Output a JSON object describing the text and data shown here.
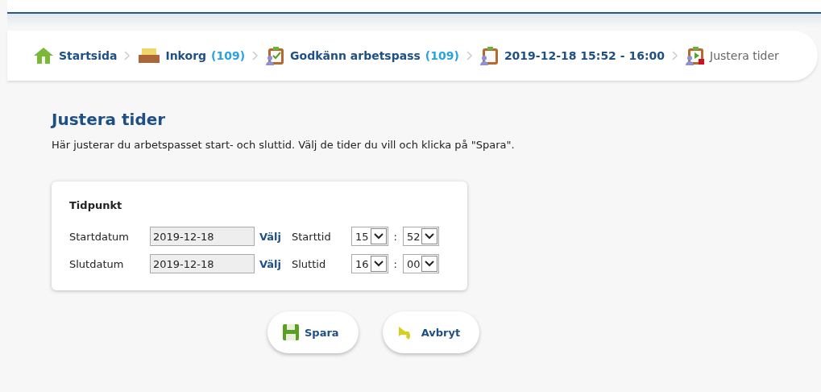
{
  "breadcrumb": [
    {
      "label": "Startsida",
      "selected": false
    },
    {
      "label": "Inkorg",
      "count": "(109)",
      "selected": false
    },
    {
      "label": "Godkänn arbetspass",
      "count": "(109)",
      "selected": false
    },
    {
      "label": "2019-12-18 15:52 - 16:00",
      "selected": false
    },
    {
      "label": "Justera tider",
      "selected": true
    }
  ],
  "heading": "Justera tider",
  "intro": "Här justerar du arbetspasset start- och sluttid. Välj de tider du vill och klicka på \"Spara\".",
  "card": {
    "title": "Tidpunkt",
    "rows": [
      {
        "date_label": "Startdatum",
        "date": "2019-12-18",
        "pick": "Välj",
        "time_label": "Starttid",
        "hour": "15",
        "separator": ":",
        "minute": "52"
      },
      {
        "date_label": "Slutdatum",
        "date": "2019-12-18",
        "pick": "Välj",
        "time_label": "Sluttid",
        "hour": "16",
        "separator": ":",
        "minute": "00"
      }
    ]
  },
  "buttons": [
    {
      "kind": "save",
      "label": "Spara"
    },
    {
      "kind": "cancel",
      "label": "Avbryt"
    }
  ]
}
